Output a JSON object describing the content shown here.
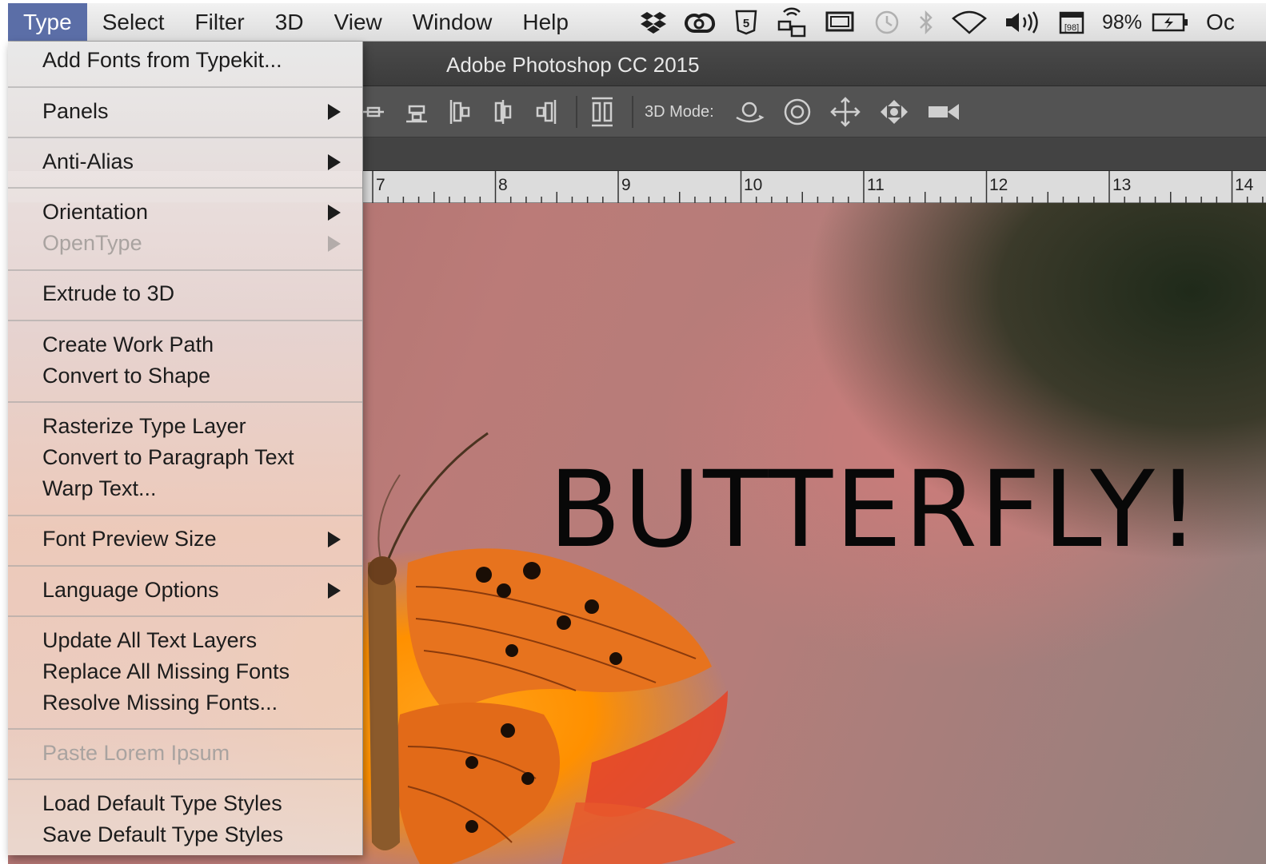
{
  "menubar": {
    "items": [
      "Type",
      "Select",
      "Filter",
      "3D",
      "View",
      "Window",
      "Help"
    ],
    "active": "Type",
    "battery_percent": "98%",
    "trailing_text": "Oc"
  },
  "window": {
    "title": "Adobe Photoshop CC 2015",
    "mode_label": "3D Mode:"
  },
  "ruler": {
    "labels": [
      "7",
      "8",
      "9",
      "10",
      "11",
      "12",
      "13",
      "14"
    ]
  },
  "canvas": {
    "text": "BUTTERFLY!"
  },
  "type_menu": {
    "add_fonts": "Add Fonts from Typekit...",
    "panels": "Panels",
    "anti_alias": "Anti-Alias",
    "orientation": "Orientation",
    "opentype": "OpenType",
    "extrude": "Extrude to 3D",
    "create_work_path": "Create Work Path",
    "convert_to_shape": "Convert to Shape",
    "rasterize": "Rasterize Type Layer",
    "convert_paragraph": "Convert to Paragraph Text",
    "warp_text": "Warp Text...",
    "font_preview_size": "Font Preview Size",
    "language_options": "Language Options",
    "update_text_layers": "Update All Text Layers",
    "replace_missing": "Replace All Missing Fonts",
    "resolve_missing": "Resolve Missing Fonts...",
    "paste_lorem": "Paste Lorem Ipsum",
    "load_default": "Load Default Type Styles",
    "save_default": "Save Default Type Styles"
  },
  "icons": {
    "status": [
      "dropbox-icon",
      "creative-cloud-icon",
      "html5-icon",
      "network-icon",
      "display-icon",
      "time-machine-icon",
      "bluetooth-icon",
      "wifi-icon",
      "volume-icon",
      "calendar-icon",
      "battery-icon"
    ],
    "options": [
      "align-vcenter-icon",
      "align-bottom-icon",
      "distribute-left-icon",
      "distribute-hcenter-icon",
      "distribute-right-icon",
      "auto-align-icon",
      "3d-rotate-icon",
      "3d-roll-icon",
      "3d-pan-icon",
      "3d-slide-icon",
      "3d-scale-icon"
    ]
  }
}
